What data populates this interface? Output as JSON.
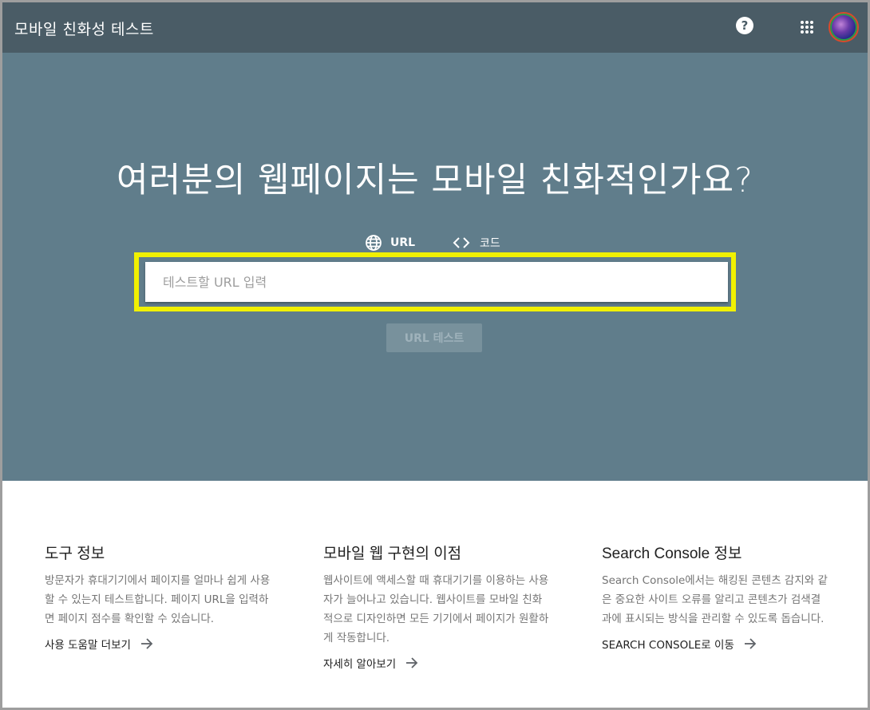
{
  "header": {
    "title": "모바일 친화성 테스트",
    "help_icon_glyph": "?",
    "colors": {
      "bar": "#4a5c66"
    }
  },
  "hero": {
    "heading": "여러분의 웹페이지는 모바일 친화적인가요?",
    "tabs": [
      {
        "label": "URL",
        "icon": "globe-icon",
        "selected": true
      },
      {
        "label": "코드",
        "icon": "code-icon",
        "selected": false
      }
    ],
    "url_input": {
      "placeholder": "테스트할 URL 입력",
      "value": ""
    },
    "test_button_label": "URL 테스트",
    "colors": {
      "background": "#607d8b",
      "tab_indicator": "#f57c00",
      "highlight_border": "#f0f000"
    }
  },
  "info": {
    "columns": [
      {
        "title": "도구 정보",
        "description": "방문자가 휴대기기에서 페이지를 얼마나 쉽게 사용할 수 있는지 테스트합니다. 페이지 URL을 입력하면 페이지 점수를 확인할 수 있습니다.",
        "link": "사용 도움말 더보기"
      },
      {
        "title": "모바일 웹 구현의 이점",
        "description": "웹사이트에 액세스할 때 휴대기기를 이용하는 사용자가 늘어나고 있습니다. 웹사이트를 모바일 친화적으로 디자인하면 모든 기기에서 페이지가 원활하게 작동합니다.",
        "link": "자세히 알아보기"
      },
      {
        "title": "Search Console 정보",
        "description": "Search Console에서는 해킹된 콘텐츠 감지와 같은 중요한 사이트 오류를 알리고 콘텐츠가 검색결과에 표시되는 방식을 관리할 수 있도록 돕습니다.",
        "link": "SEARCH CONSOLE로 이동"
      }
    ]
  }
}
